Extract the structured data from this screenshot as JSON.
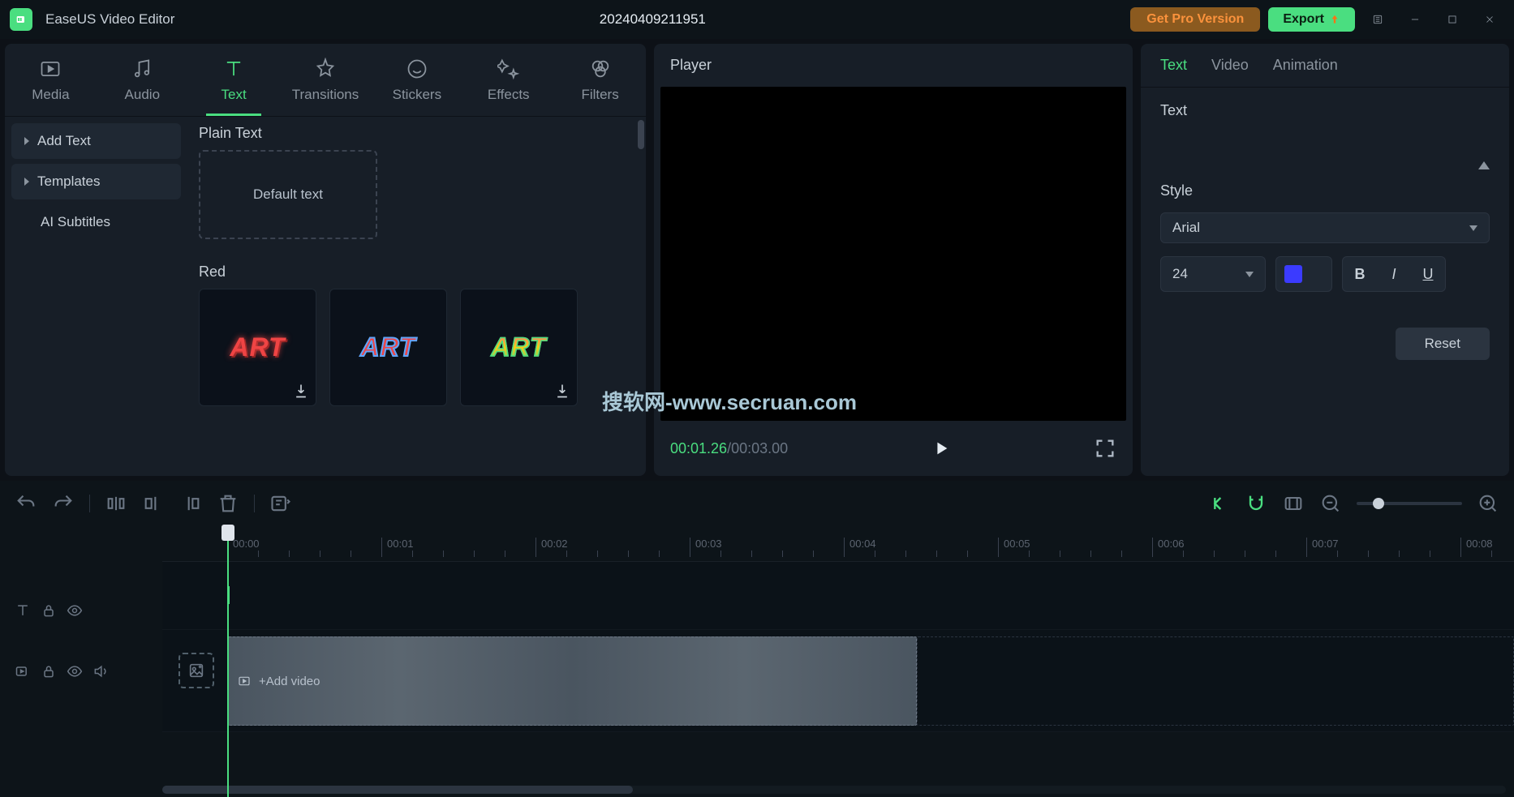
{
  "titlebar": {
    "app_title": "EaseUS Video Editor",
    "project_title": "20240409211951",
    "pro_button": "Get Pro Version",
    "export_button": "Export"
  },
  "tabs": {
    "media": "Media",
    "audio": "Audio",
    "text": "Text",
    "transitions": "Transitions",
    "stickers": "Stickers",
    "effects": "Effects",
    "filters": "Filters"
  },
  "sidebar": {
    "add_text": "Add Text",
    "templates": "Templates",
    "ai_subtitles": "AI Subtitles"
  },
  "assets": {
    "plain_text": "Plain Text",
    "default_text": "Default text",
    "red_section": "Red",
    "art_label": "ART"
  },
  "player": {
    "title": "Player",
    "current_time": "00:01.26",
    "sep": "/",
    "total_time": "00:03.00",
    "watermark": "搜软网-www.secruan.com"
  },
  "right_panel": {
    "tab_text": "Text",
    "tab_video": "Video",
    "tab_animation": "Animation",
    "text_label": "Text",
    "style_label": "Style",
    "font_family": "Arial",
    "font_size": "24",
    "color": "#3b3bff",
    "bold": "B",
    "italic": "I",
    "underline": "U",
    "reset": "Reset"
  },
  "timeline": {
    "marks": [
      "00:00",
      "00:01",
      "00:02",
      "00:03",
      "00:04",
      "00:05",
      "00:06",
      "00:07",
      "00:08"
    ],
    "clip_label": "+Add video"
  }
}
